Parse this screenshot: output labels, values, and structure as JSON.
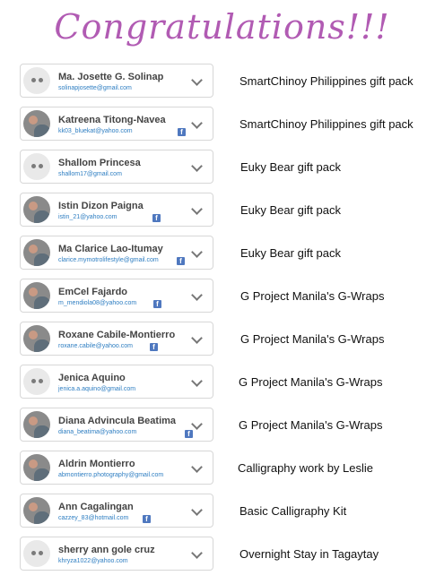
{
  "title": "Congratulations!!!",
  "rows": [
    {
      "name": "Ma. Josette G. Solinap",
      "email": "solinapjosette@gmail.com",
      "prize": "SmartChinoy Philippines gift pack"
    },
    {
      "name": "Katreena Titong-Navea",
      "email": "kk03_bluekat@yahoo.com",
      "prize": "SmartChinoy Philippines gift pack"
    },
    {
      "name": "Shallom Princesa",
      "email": "shallom17@gmail.com",
      "prize": "Euky Bear gift pack"
    },
    {
      "name": "Istin Dizon Paigna",
      "email": "istin_21@yahoo.com",
      "prize": "Euky Bear gift pack"
    },
    {
      "name": "Ma Clarice Lao-Itumay",
      "email": "clarice.mymotrolifestyle@gmail.com",
      "prize": "Euky Bear gift pack"
    },
    {
      "name": "EmCel Fajardo",
      "email": "m_mendiola08@yahoo.com",
      "prize": "G Project Manila's G-Wraps"
    },
    {
      "name": "Roxane Cabile-Montierro",
      "email": "roxane.cabile@yahoo.com",
      "prize": "G Project Manila's G-Wraps"
    },
    {
      "name": "Jenica Aquino",
      "email": "jenica.a.aquino@gmail.com",
      "prize": "G Project Manila's G-Wraps"
    },
    {
      "name": "Diana Advincula Beatima",
      "email": "diana_beatima@yahoo.com",
      "prize": "G Project Manila's G-Wraps"
    },
    {
      "name": "Aldrin Montierro",
      "email": "abmontierro.photography@gmail.com",
      "prize": "Calligraphy work by Leslie"
    },
    {
      "name": "Ann Cagalingan",
      "email": "cazzey_83@hotmail.com",
      "prize": "Basic Calligraphy Kit"
    },
    {
      "name": "sherry ann gole cruz",
      "email": "khryza1022@yahoo.com",
      "prize": "Overnight Stay in Tagaytay"
    }
  ],
  "icons": {
    "avatar": "user-avatar-icon",
    "facebook": "facebook-icon",
    "chevron": "chevron-down-icon"
  }
}
